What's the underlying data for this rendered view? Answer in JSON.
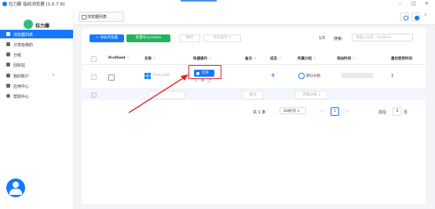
{
  "window": {
    "title": "拉力藤 指纹浏览器 [1.0.7.9]",
    "controls": [
      "–",
      "□",
      "×"
    ]
  },
  "sidebar": {
    "brand": "拉力藤",
    "items": [
      {
        "label": "浏览器列表",
        "icon": "list-icon",
        "active": true
      },
      {
        "label": "分享给我的",
        "icon": "folder-share-icon"
      },
      {
        "label": "分组",
        "icon": "group-icon"
      },
      {
        "label": "回收站",
        "icon": "trash-icon"
      },
      {
        "label": "我的账户",
        "icon": "user-icon",
        "expandable": true
      },
      {
        "label": "应用中心",
        "icon": "apps-icon"
      },
      {
        "label": "帮助中心",
        "icon": "help-icon"
      }
    ]
  },
  "tabbar": {
    "tab_label": "浏览器列表"
  },
  "toolbar": {
    "add_label": "+ 添加浏览器",
    "import_label": "批量导入cookie",
    "delete_label": "删除",
    "more_label": "更多操作 ∨",
    "page_fraction": "1/5",
    "search_label": "搜索:",
    "search_placeholder": "请输入名称、ProfileId"
  },
  "table": {
    "headers": {
      "profile_id": "ProfileId",
      "name": "名称",
      "quick_ops": "快捷操作",
      "remark": "备注",
      "members": "成员",
      "group": "所属分组",
      "created": "添加时间",
      "last_used": "最后使用时间"
    },
    "row": {
      "name": "Proxy302",
      "open_label": "打开",
      "members": "0",
      "group": "默认分组",
      "last_used": "1"
    },
    "ghost": {
      "remark": "备注",
      "group": "所属分组 ∨"
    }
  },
  "pagination": {
    "total": "共 1 条",
    "page_size": "20条/页 ∨",
    "prev": "<",
    "current": "1",
    "next": ">",
    "goto_label": "前往",
    "goto_value": "1",
    "page_suffix": "页"
  },
  "colors": {
    "primary": "#1677ff",
    "green": "#22b35e",
    "highlight": "#e8242a"
  }
}
